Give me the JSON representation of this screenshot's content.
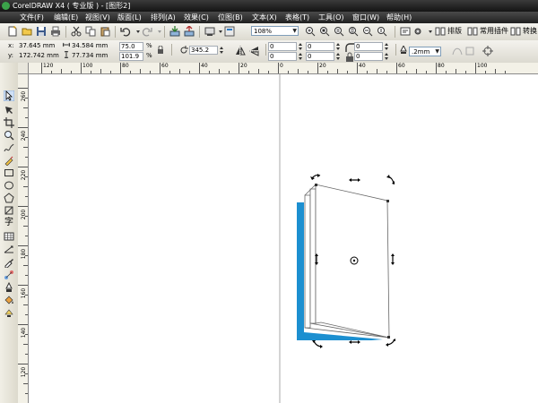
{
  "window": {
    "title": "CorelDRAW X4 ( 专业版 ) - [图形2]"
  },
  "menu": [
    {
      "label": "文件(F)",
      "key": "file"
    },
    {
      "label": "编辑(E)",
      "key": "edit"
    },
    {
      "label": "视图(V)",
      "key": "view"
    },
    {
      "label": "版面(L)",
      "key": "layout"
    },
    {
      "label": "排列(A)",
      "key": "arrange"
    },
    {
      "label": "效果(C)",
      "key": "effects"
    },
    {
      "label": "位图(B)",
      "key": "bitmaps"
    },
    {
      "label": "文本(X)",
      "key": "text"
    },
    {
      "label": "表格(T)",
      "key": "table"
    },
    {
      "label": "工具(O)",
      "key": "tools"
    },
    {
      "label": "窗口(W)",
      "key": "window"
    },
    {
      "label": "帮助(H)",
      "key": "help"
    }
  ],
  "standard_toolbar": {
    "zoom_level": "108%",
    "layout_button": "排版",
    "plugin_button": "常用插件",
    "convert_button": "转换"
  },
  "property_bar": {
    "x_label": "x:",
    "x_value": "37.645 mm",
    "y_label": "y:",
    "y_value": "172.742 mm",
    "width_value": "34.584 mm",
    "height_value": "77.734 mm",
    "scale_x": "75.0",
    "scale_y": "101.9",
    "percent": "%",
    "rotation": "345.2",
    "skew_fields": [
      "0",
      "0",
      "0",
      "0",
      "0",
      "0"
    ],
    "outline_width": ".2mm"
  },
  "ruler": {
    "h_labels": [
      "120",
      "100",
      "80",
      "60",
      "40",
      "20",
      "0",
      "20",
      "40",
      "60",
      "80",
      "100"
    ],
    "v_labels": [
      "260",
      "240",
      "220",
      "200",
      "180",
      "160",
      "140",
      "120"
    ]
  },
  "colors": {
    "accent_blue": "#1c8fd0",
    "titlebar": "#1c1c1c"
  }
}
